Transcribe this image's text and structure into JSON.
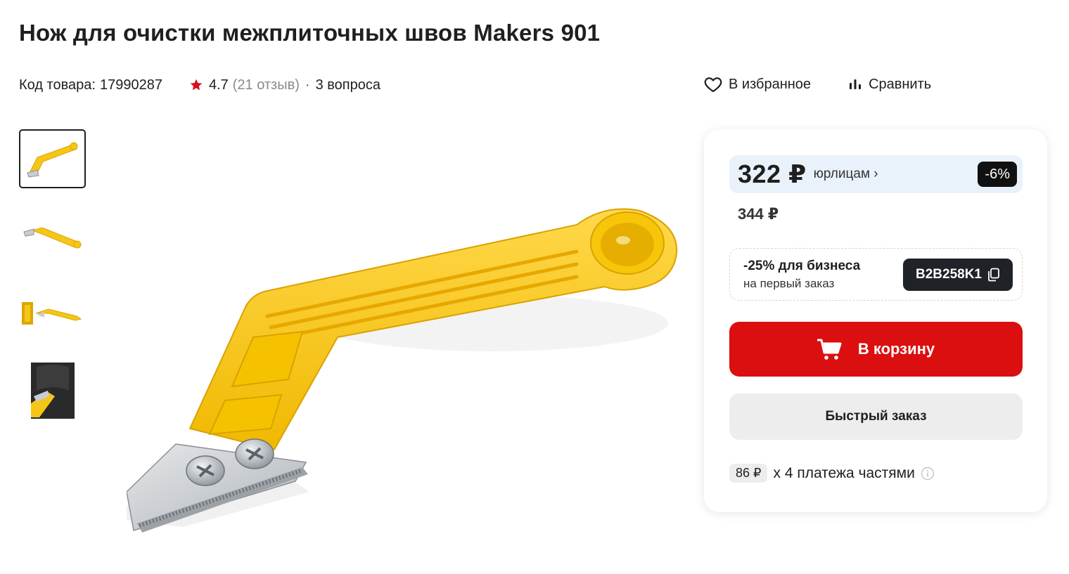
{
  "product": {
    "title": "Нож для очистки межплиточных швов Makers 901",
    "code_label": "Код товара:",
    "code": "17990287",
    "rating": "4.7",
    "reviews": "(21 отзыв)",
    "separator": "·",
    "questions": "3 вопроса"
  },
  "actions": {
    "favorite": "В избранное",
    "compare": "Сравнить"
  },
  "gallery": {
    "thumbnails": [
      "thumb-1",
      "thumb-2",
      "thumb-3",
      "thumb-4"
    ],
    "active_index": 0
  },
  "buy_box": {
    "price": "322 ₽",
    "price_legal_label": "юрлицам ›",
    "discount": "-6%",
    "old_price": "344 ₽",
    "promo": {
      "title": "-25% для бизнеса",
      "subtitle": "на первый заказ",
      "code": "B2B258K1"
    },
    "add_to_cart": "В корзину",
    "quick_order": "Быстрый заказ",
    "installment_price": "86 ₽",
    "installment_text": "х 4 платежа частями"
  },
  "colors": {
    "accent_red": "#db0f0f",
    "price_bg": "#e9f2fb",
    "badge_dark": "#111111",
    "star": "#d90d1f",
    "handle_yellow": "#f5c518"
  },
  "icons": [
    "star-icon",
    "heart-icon",
    "compare-icon",
    "copy-icon",
    "cart-icon",
    "info-icon"
  ]
}
